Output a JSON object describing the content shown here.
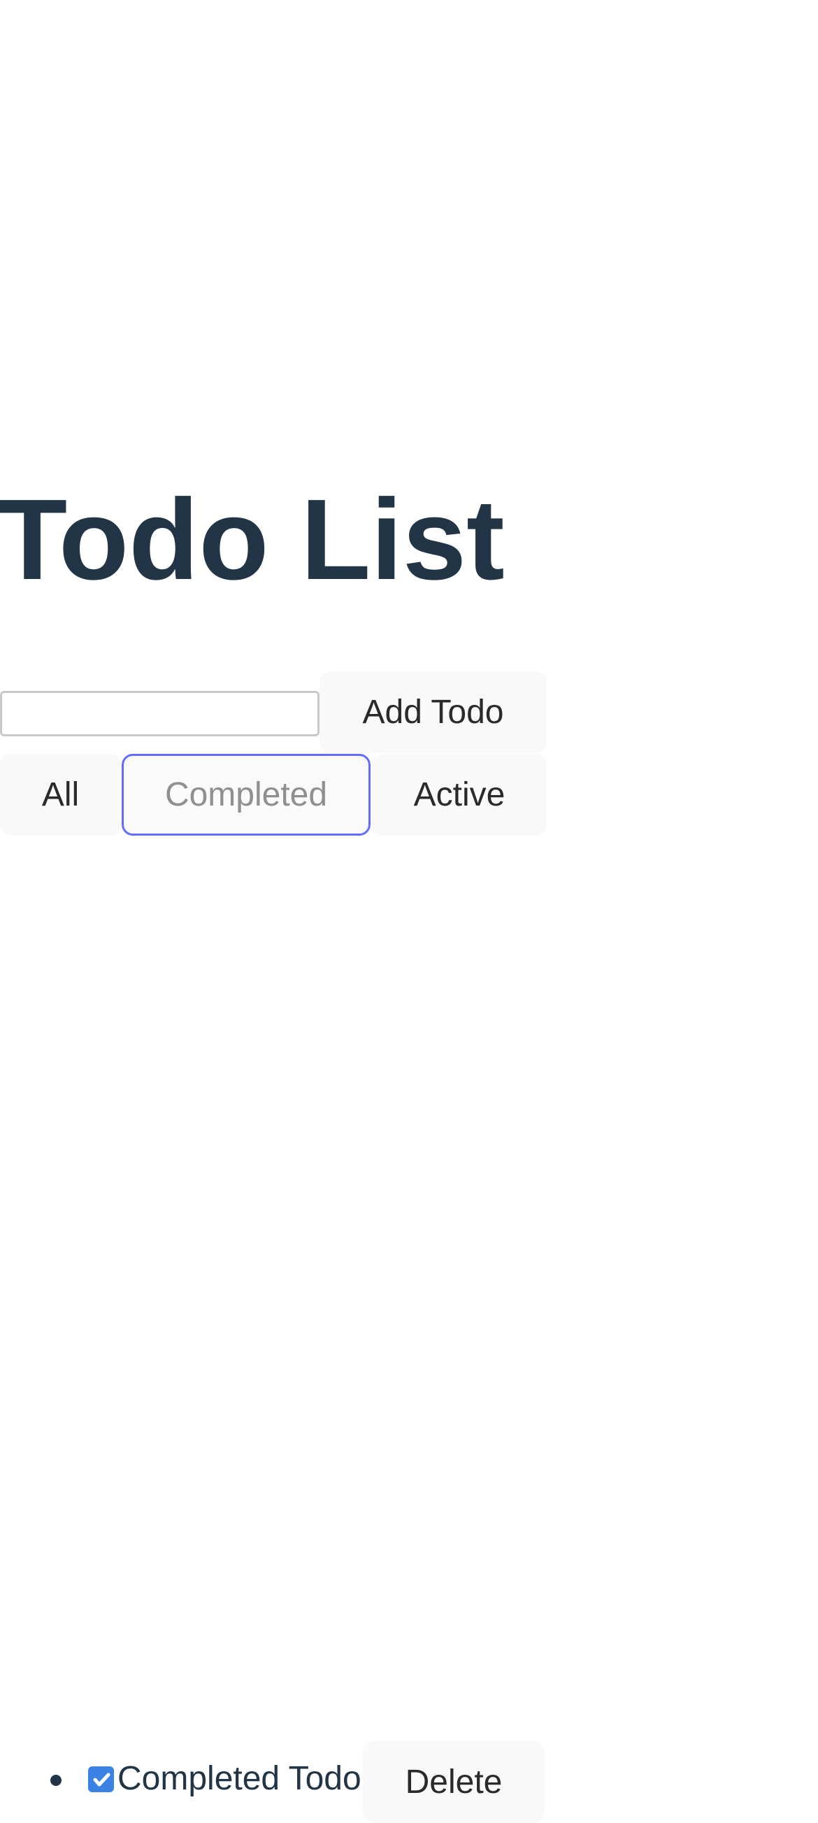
{
  "header": {
    "title": "Todo List"
  },
  "new_todo": {
    "value": "",
    "placeholder": "",
    "add_label": "Add Todo"
  },
  "filters": {
    "all_label": "All",
    "completed_label": "Completed",
    "active_label": "Active",
    "selected": "Completed"
  },
  "todos": [
    {
      "text": "Completed Todo",
      "completed": true,
      "delete_label": "Delete"
    }
  ],
  "colors": {
    "heading": "#213547",
    "focus_outline": "#646cff",
    "checkbox": "#3b82e5",
    "button_bg": "#f9f9f9"
  },
  "icons": {
    "checkbox": "checkmark-icon",
    "bullet": "bullet-icon"
  }
}
